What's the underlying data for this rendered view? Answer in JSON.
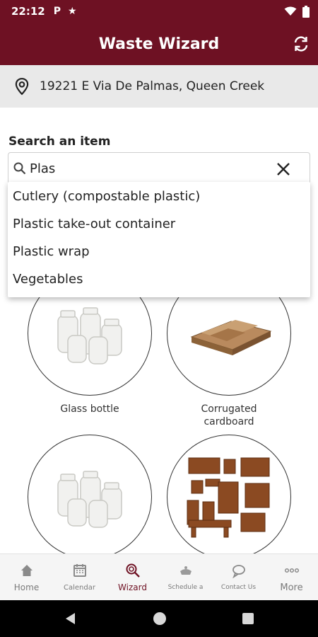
{
  "status_bar": {
    "time": "22:12",
    "icons": [
      "parking-icon",
      "star-icon",
      "wifi-icon",
      "battery-icon"
    ],
    "parking_glyph": "P",
    "star_glyph": "★"
  },
  "app": {
    "title": "Waste Wizard",
    "bar_color": "#6e1123"
  },
  "address": {
    "text": "19221 E Via De Palmas, Queen Creek"
  },
  "search": {
    "label": "Search an item",
    "value": "Plas"
  },
  "suggestions": [
    "Cutlery (compostable plastic)",
    "Plastic take-out container",
    "Plastic wrap",
    "Vegetables"
  ],
  "items": [
    {
      "label": "Glass bottle",
      "image": "glass-jars"
    },
    {
      "label": "Corrugated cardboard",
      "label_lines": [
        "Corrugated",
        "cardboard"
      ],
      "image": "flattened-cardboard"
    },
    {
      "label": "",
      "image": "glass-jars"
    },
    {
      "label": "",
      "image": "wooden-furniture"
    }
  ],
  "bottom_nav": [
    {
      "label": "Home",
      "icon": "home-icon",
      "active": false
    },
    {
      "label": "Calendar",
      "icon": "calendar-icon",
      "active": false
    },
    {
      "label": "Wizard",
      "icon": "wizard-icon",
      "active": true
    },
    {
      "label": "Schedule a",
      "icon": "schedule-icon",
      "active": false
    },
    {
      "label": "Contact Us",
      "icon": "chat-icon",
      "active": false
    },
    {
      "label": "More",
      "icon": "more-icon",
      "active": false
    }
  ]
}
